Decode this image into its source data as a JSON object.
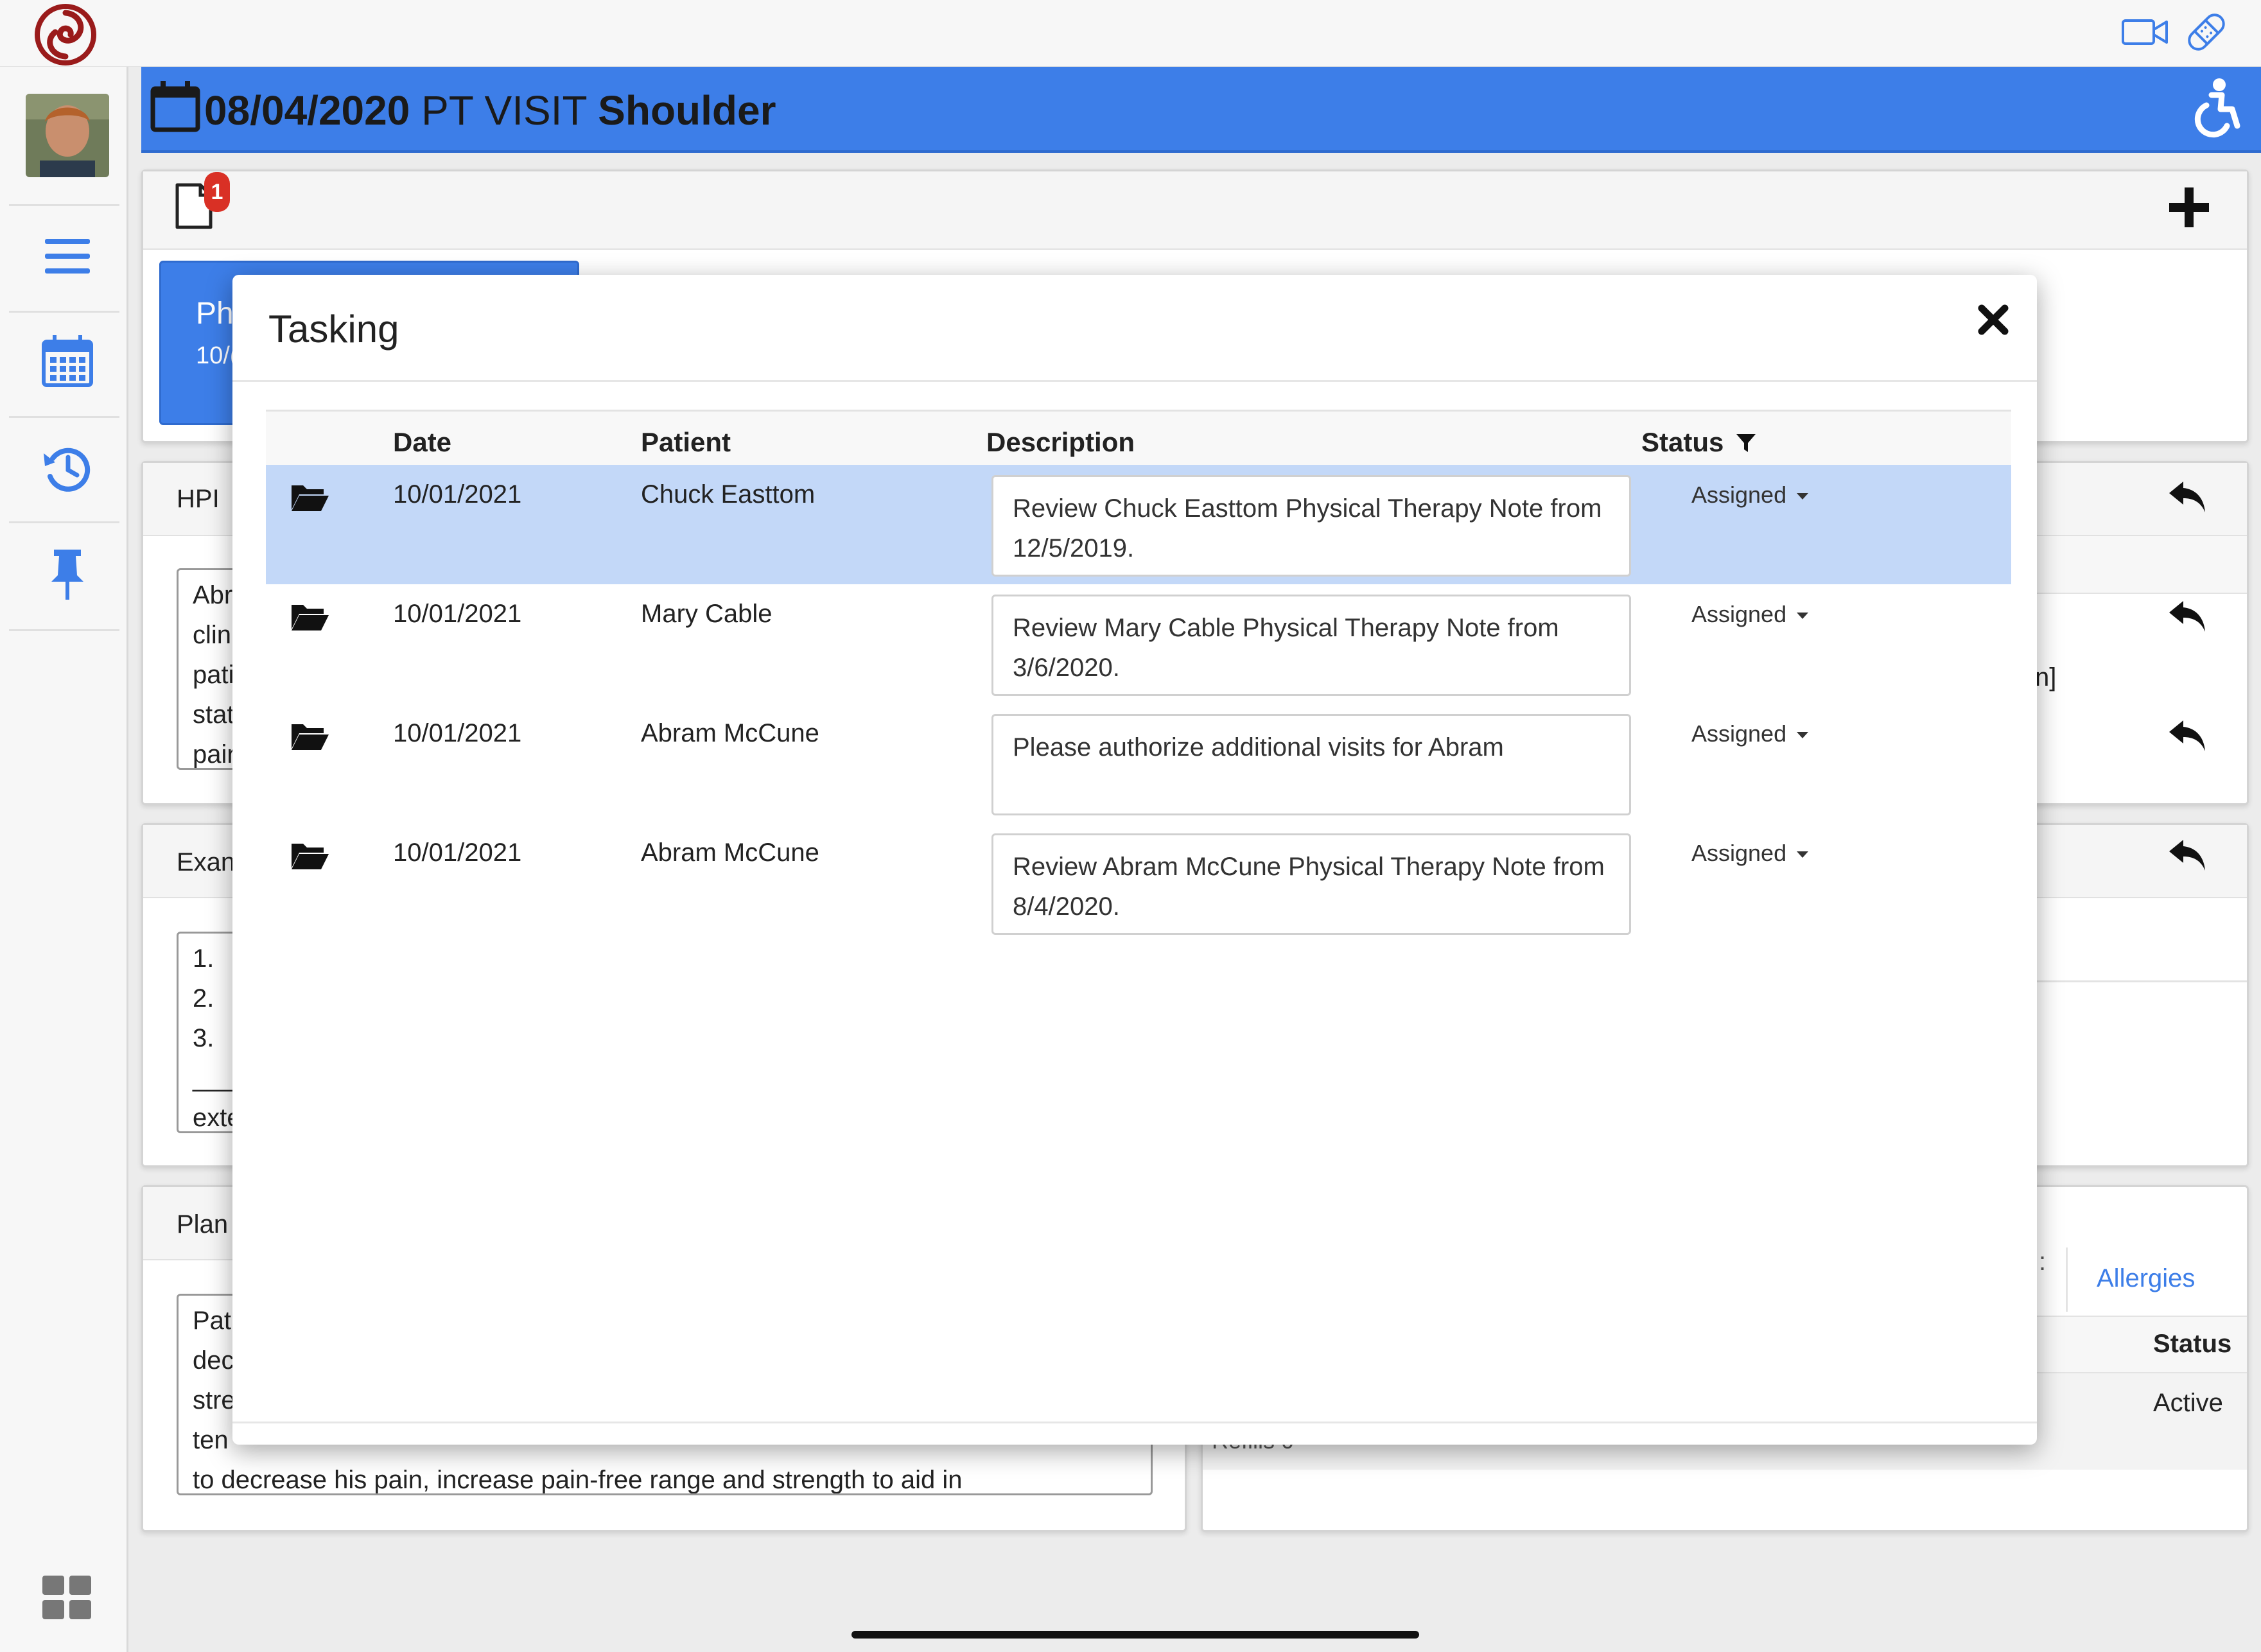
{
  "header": {
    "date": "08/04/2020",
    "visit_type": "PT VISIT",
    "body_part": "Shoulder"
  },
  "notification": {
    "count": "1"
  },
  "background_card": {
    "title": "Ph",
    "date": "10/("
  },
  "sections": {
    "hpi": {
      "label": "HPI",
      "lines": [
        "Abr",
        "clin",
        "pati",
        "stat",
        "pair"
      ]
    },
    "exam": {
      "label": "Exan",
      "lines": [
        "1.",
        "2.",
        "3.",
        "___",
        "exte"
      ]
    },
    "plan": {
      "label": "Plan",
      "lines": [
        "Pati",
        "dec",
        "stre",
        "ten"
      ],
      "full_line": "to decrease his pain, increase pain-free range and strength to aid in"
    }
  },
  "right_panel": {
    "fragment": "n]",
    "tab_allergies": "Allergies",
    "tab_prev_fragment": ":",
    "col_status": "Status",
    "row_status": "Active",
    "refills_fragment": "Refills 0"
  },
  "modal": {
    "title": "Tasking",
    "columns": {
      "date": "Date",
      "patient": "Patient",
      "description": "Description",
      "status": "Status"
    },
    "rows": [
      {
        "date": "10/01/2021",
        "patient": "Chuck Easttom",
        "description": "Review Chuck Easttom Physical Therapy  Note from 12/5/2019.",
        "status": "Assigned"
      },
      {
        "date": "10/01/2021",
        "patient": "Mary Cable",
        "description": "Review Mary Cable Physical Therapy  Note from 3/6/2020.",
        "status": "Assigned"
      },
      {
        "date": "10/01/2021",
        "patient": "Abram McCune",
        "description": "Please authorize additional visits for Abram",
        "status": "Assigned"
      },
      {
        "date": "10/01/2021",
        "patient": "Abram McCune",
        "description": "Review Abram McCune Physical Therapy  Note from 8/4/2020.",
        "status": "Assigned"
      }
    ]
  },
  "colors": {
    "brand_blue": "#3d7ee8",
    "selected_row": "#c3d8f8",
    "logo_red": "#9a1b1b",
    "badge_red": "#d93025"
  },
  "icons": {
    "logo": "swirl-logo",
    "video": "video-camera-icon",
    "bandage": "bandage-icon",
    "accessibility": "wheelchair-icon",
    "menu": "hamburger-icon",
    "calendar": "calendar-icon",
    "history": "history-icon",
    "pin": "pin-icon",
    "grid": "grid-icon",
    "document": "document-icon",
    "add": "plus-icon",
    "close": "close-icon",
    "filter": "filter-icon",
    "folder": "folder-open-icon",
    "reply": "reply-icon"
  }
}
